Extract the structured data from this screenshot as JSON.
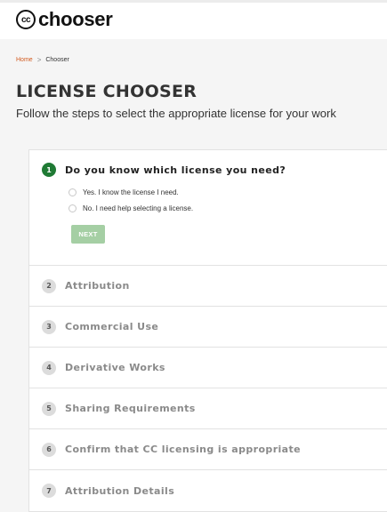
{
  "header": {
    "logo_mark": "cc",
    "logo_text": "chooser"
  },
  "breadcrumb": {
    "home": "Home",
    "separator": ">",
    "current": "Chooser"
  },
  "page": {
    "title": "LICENSE CHOOSER",
    "subtitle": "Follow the steps to select the appropriate license for your work"
  },
  "active_step": {
    "number": "1",
    "title": "Do you know which license you need?",
    "options": [
      "Yes. I know the license I need.",
      "No. I need help selecting a license."
    ],
    "next_label": "NEXT"
  },
  "steps": [
    {
      "number": "2",
      "title": "Attribution"
    },
    {
      "number": "3",
      "title": "Commercial Use"
    },
    {
      "number": "4",
      "title": "Derivative Works"
    },
    {
      "number": "5",
      "title": "Sharing Requirements"
    },
    {
      "number": "6",
      "title": "Confirm that CC licensing is appropriate"
    },
    {
      "number": "7",
      "title": "Attribution Details"
    }
  ],
  "colors": {
    "accent_green": "#1f7a34",
    "next_button": "#a5cfa4",
    "home_link": "#d25a1e"
  }
}
